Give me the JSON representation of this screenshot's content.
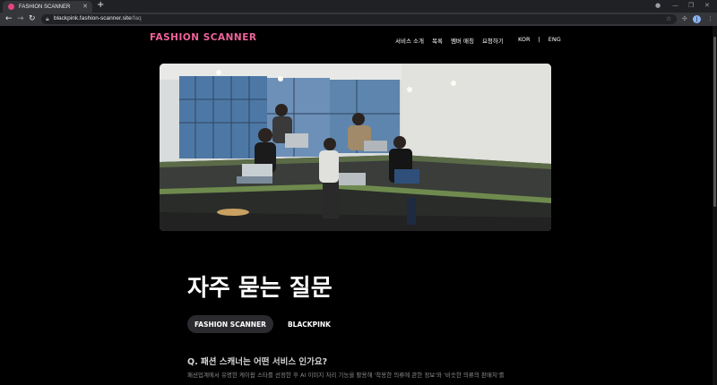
{
  "browser": {
    "tab_title": "FASHION SCANNER",
    "url_host": "blackpink.fashion-scanner.site",
    "url_path": "/faq",
    "profile_initial": "J"
  },
  "header": {
    "logo": "FASHION SCANNER",
    "nav": [
      "서비스 소개",
      "목록",
      "멤버 매칭",
      "요청하기"
    ],
    "lang_kor": "KOR",
    "lang_sep": "|",
    "lang_eng": "ENG"
  },
  "faq": {
    "title": "자주 묻는 질문",
    "tabs": [
      {
        "label": "FASHION SCANNER",
        "active": true
      },
      {
        "label": "BLACKPINK",
        "active": false
      }
    ],
    "question": "Q. 패션 스캐너는 어떤 서비스 인가요?",
    "answer": "패션업계에서 유명한 케이팝 스타를 선정한 후 AI 이미지 처리 기능을 활용해 '착용한 의류에 관한 정보'와 '비슷한 의류의 판매처'를"
  },
  "colors": {
    "brand_pink": "#f0629a",
    "background": "#000000",
    "active_tab_bg": "#2b2b2f"
  },
  "icons": [
    "back-icon",
    "forward-icon",
    "reload-icon",
    "lock-icon",
    "star-icon",
    "puzzle-icon",
    "close-icon",
    "plus-icon"
  ]
}
